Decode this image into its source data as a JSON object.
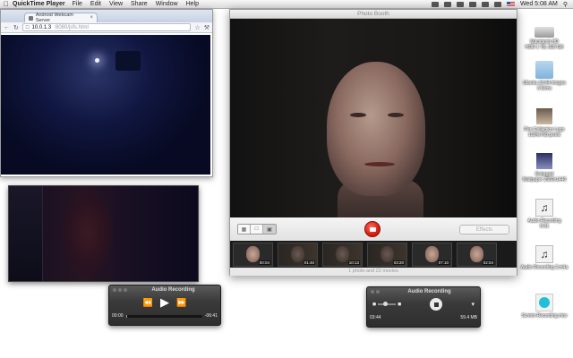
{
  "menubar": {
    "app_name": "QuickTime Player",
    "items": [
      "File",
      "Edit",
      "View",
      "Share",
      "Window",
      "Help"
    ],
    "clock": "Wed 5:08 AM"
  },
  "browser": {
    "tab_title": "Android Webcam Server",
    "url_host": "10.0.1.3",
    "url_rest": ":8080/jsfs.html"
  },
  "photobooth": {
    "title": "Photo Booth",
    "effects_label": "Effects",
    "status": "1 photo and 22 movies",
    "thumbs": [
      "00:04",
      "01:40",
      "10:13",
      "03:20",
      "07:10",
      "02:04"
    ]
  },
  "audio1": {
    "title": "Audio Recording",
    "time_elapsed": "00:00",
    "time_remaining": "-06:41",
    "progress": 0.02
  },
  "audio2": {
    "title": "Audio Recording",
    "time": "03:44",
    "size": "59.4 MB"
  },
  "desktop": {
    "items": [
      {
        "label": "Macintosh HD",
        "sub": "HDD 1 TB, 500 GB"
      },
      {
        "label": "Ubuntu 10.04 Images",
        "sub": "3 items"
      },
      {
        "label": "Pen Collection Logo",
        "sub": "1024x768 pixels"
      },
      {
        "label": "Enlarged",
        "sub": "Wallpaper 2560x1440"
      },
      {
        "label": "Audio Recording",
        "sub": "6:41"
      },
      {
        "label": "Audio Recording 2.m4a",
        "sub": ""
      },
      {
        "label": "Screen Recording.mov",
        "sub": ""
      }
    ]
  }
}
